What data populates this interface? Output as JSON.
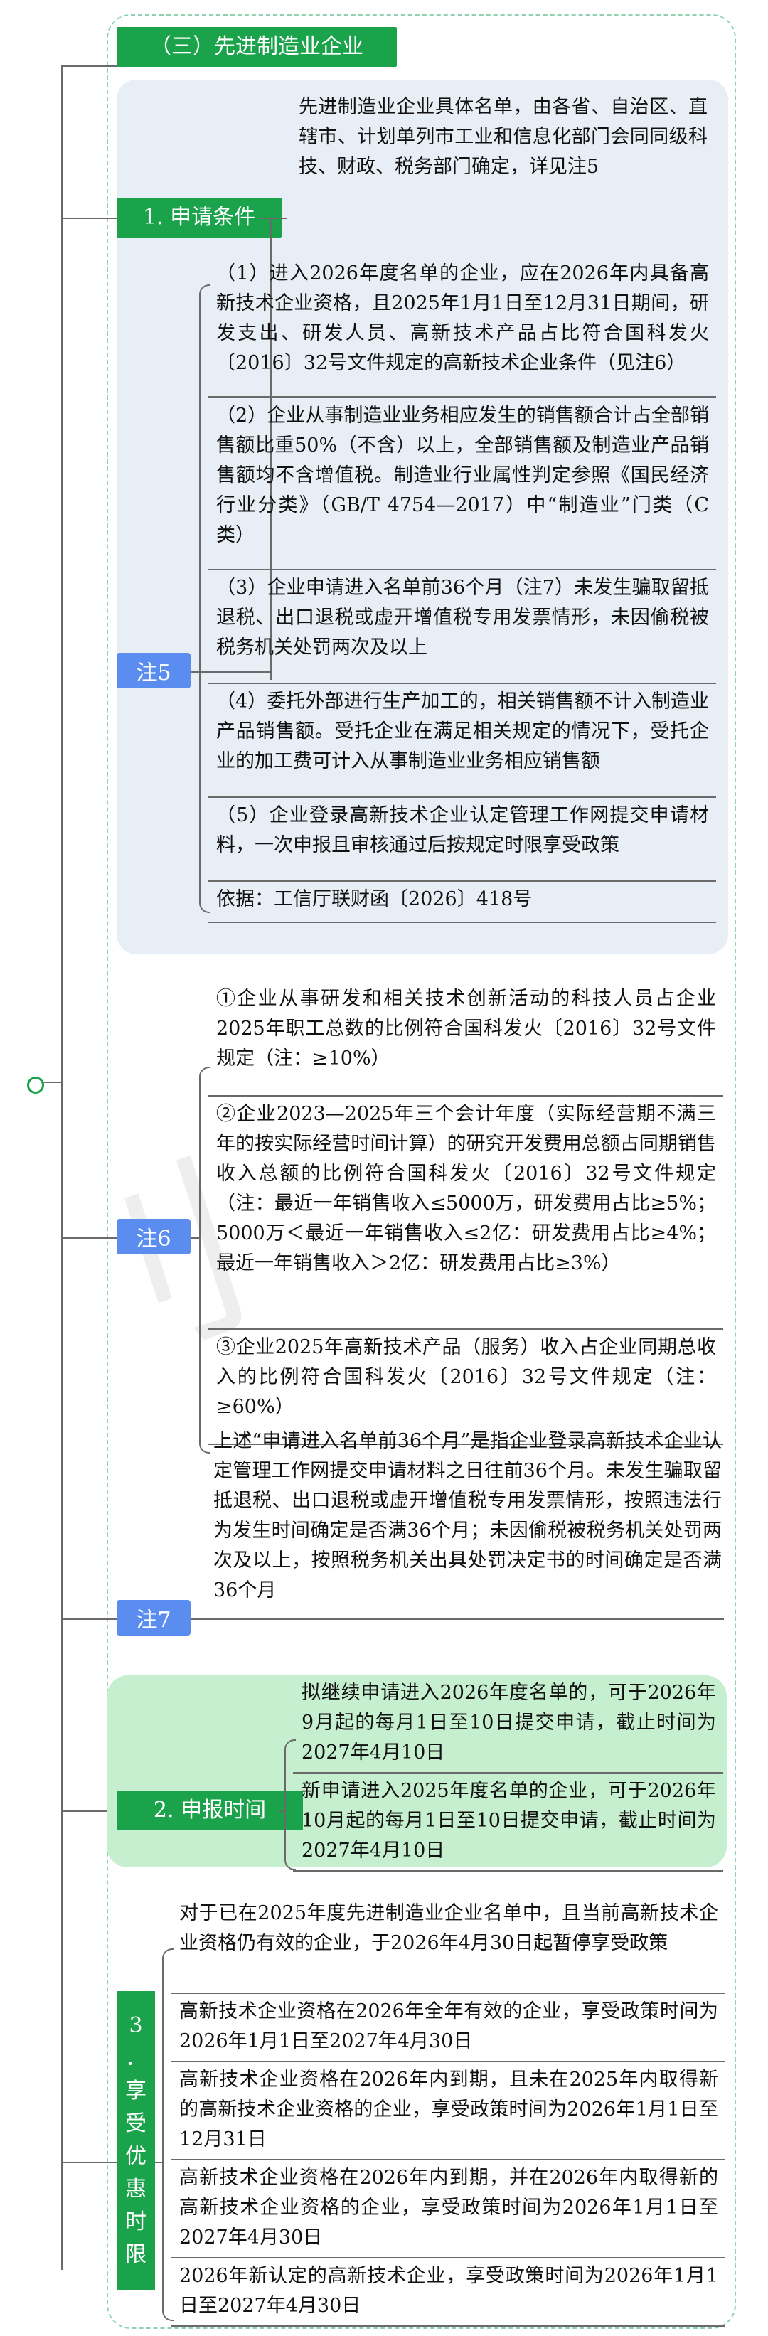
{
  "section_title": "（三）先进制造业企业",
  "condition": {
    "tag": "1. 申请条件",
    "intro": "先进制造业企业具体名单，由各省、自治区、直辖市、计划单列市工业和信息化部门会同同级科技、财政、税务部门确定，详见注5"
  },
  "note5": {
    "tag": "注5",
    "items": [
      "（1）进入2026年度名单的企业，应在2026年内具备高新技术企业资格，且2025年1月1日至12月31日期间，研发支出、研发人员、高新技术产品占比符合国科发火〔2016〕32号文件规定的高新技术企业条件（见注6）",
      "（2）企业从事制造业业务相应发生的销售额合计占全部销售额比重50%（不含）以上，全部销售额及制造业产品销售额均不含增值税。制造业行业属性判定参照《国民经济行业分类》（GB/T 4754—2017）中“制造业”门类（C类）",
      "（3）企业申请进入名单前36个月（注7）未发生骗取留抵退税、出口退税或虚开增值税专用发票情形，未因偷税被税务机关处罚两次及以上",
      "（4）委托外部进行生产加工的，相关销售额不计入制造业产品销售额。受托企业在满足相关规定的情况下，受托企业的加工费可计入从事制造业业务相应销售额",
      "（5）企业登录高新技术企业认定管理工作网提交申请材料，一次申报且审核通过后按规定时限享受政策",
      "依据：工信厅联财函〔2026〕418号"
    ]
  },
  "note6": {
    "tag": "注6",
    "items": [
      "①企业从事研发和相关技术创新活动的科技人员占企业2025年职工总数的比例符合国科发火〔2016〕32号文件规定（注：≥10%）",
      "②企业2023—2025年三个会计年度（实际经营期不满三年的按实际经营时间计算）的研究开发费用总额占同期销售收入总额的比例符合国科发火〔2016〕32号文件规定（注：最近一年销售收入≤5000万，研发费用占比≥5%；5000万＜最近一年销售收入≤2亿：研发费用占比≥4%；最近一年销售收入＞2亿：研发费用占比≥3%）",
      "③企业2025年高新技术产品（服务）收入占企业同期总收入的比例符合国科发火〔2016〕32号文件规定（注：≥60%）"
    ]
  },
  "note7": {
    "tag": "注7",
    "text": "上述“申请进入名单前36个月”是指企业登录高新技术企业认定管理工作网提交申请材料之日往前36个月。未发生骗取留抵退税、出口退税或虚开增值税专用发票情形，按照违法行为发生时间确定是否满36个月；未因偷税被税务机关处罚两次及以上，按照税务机关出具处罚决定书的时间确定是否满36个月"
  },
  "apply_time": {
    "tag": "2. 申报时间",
    "items": [
      "拟继续申请进入2026年度名单的，可于2026年9月起的每月1日至10日提交申请，截止时间为2027年4月10日",
      "新申请进入2025年度名单的企业，可于2026年10月起的每月1日至10日提交申请，截止时间为2027年4月10日"
    ]
  },
  "period": {
    "tag_chars": [
      "3",
      "．",
      "享",
      "受",
      "优",
      "惠",
      "时",
      "限"
    ],
    "intro": "对于已在2025年度先进制造业企业名单中，且当前高新技术企业资格仍有效的企业，于2026年4月30日起暂停享受政策",
    "items": [
      "高新技术企业资格在2026年全年有效的企业，享受政策时间为2026年1月1日至2027年4月30日",
      "高新技术企业资格在2026年内到期，且未在2025年内取得新的高新技术企业资格的企业，享受政策时间为2026年1月1日至12月31日",
      "高新技术企业资格在2026年内到期，并在2026年内取得新的高新技术企业资格的企业，享受政策时间为2026年1月1日至2027年4月30日",
      "2026年新认定的高新技术企业，享受政策时间为2026年1月1日至2027年4月30日"
    ]
  },
  "colors": {
    "green": "#1aa34a",
    "blue": "#5b8cf0",
    "panel": "#e8eef6",
    "panel_green": "#c6efd0"
  }
}
